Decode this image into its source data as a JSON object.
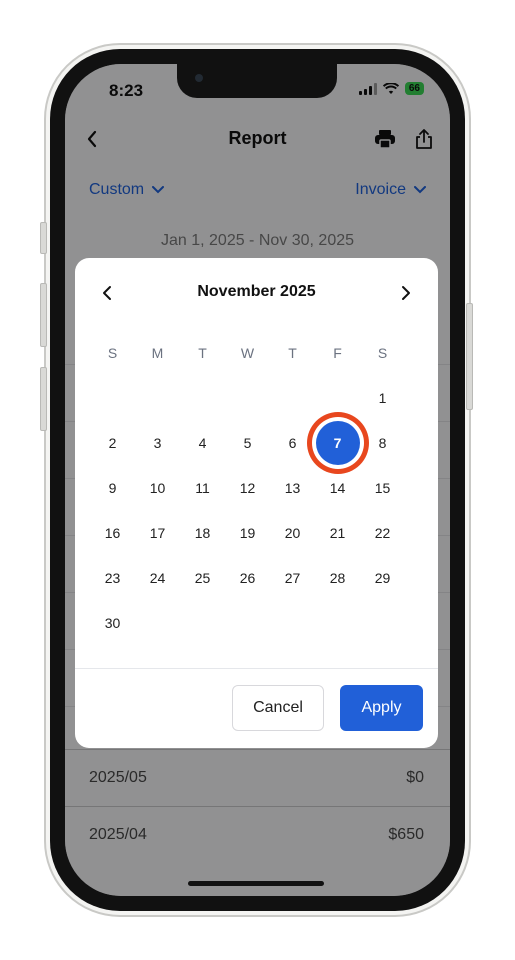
{
  "status_bar": {
    "time": "8:23",
    "battery": "66"
  },
  "nav": {
    "title": "Report"
  },
  "filters": {
    "period": "Custom",
    "type": "Invoice"
  },
  "date_range": "Jan 1, 2025 - Nov 30, 2025",
  "calendar": {
    "month": "November 2025",
    "weekdays": [
      "S",
      "M",
      "T",
      "W",
      "T",
      "F",
      "S"
    ],
    "weeks": [
      [
        "",
        "",
        "",
        "",
        "",
        "",
        "1"
      ],
      [
        "2",
        "3",
        "4",
        "5",
        "6",
        "7",
        "8"
      ],
      [
        "9",
        "10",
        "11",
        "12",
        "13",
        "14",
        "15"
      ],
      [
        "16",
        "17",
        "18",
        "19",
        "20",
        "21",
        "22"
      ],
      [
        "23",
        "24",
        "25",
        "26",
        "27",
        "28",
        "29"
      ],
      [
        "30",
        "",
        "",
        "",
        "",
        "",
        ""
      ]
    ],
    "selected_day": "7",
    "cancel_label": "Cancel",
    "apply_label": "Apply"
  },
  "rows": [
    {
      "period": "2025/05",
      "amount": "$0"
    },
    {
      "period": "2025/04",
      "amount": "$650"
    }
  ],
  "colors": {
    "accent": "#2160d8",
    "highlight_ring": "#e8471e"
  }
}
